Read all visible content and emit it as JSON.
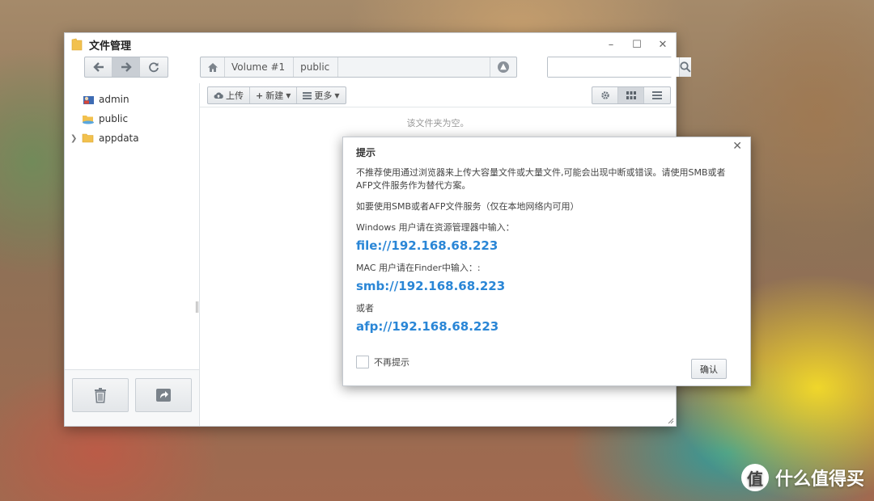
{
  "window": {
    "title": "文件管理",
    "controls": [
      "minimize-icon",
      "maximize-icon",
      "close-icon"
    ]
  },
  "path": {
    "crumbs": [
      "Volume #1",
      "public"
    ]
  },
  "search": {
    "value": "",
    "placeholder": ""
  },
  "sidebar": {
    "items": [
      {
        "label": "admin",
        "icon": "user-folder-icon"
      },
      {
        "label": "public",
        "icon": "shared-folder-icon"
      },
      {
        "label": "appdata",
        "icon": "folder-icon",
        "expandable": true
      }
    ]
  },
  "toolbar": {
    "upload_label": "上传",
    "new_label": "新建",
    "more_label": "更多"
  },
  "content": {
    "empty_message": "该文件夹为空。"
  },
  "dialog": {
    "title": "提示",
    "warning": "不推荐使用通过浏览器来上传大容量文件或大量文件,可能会出现中断或错误。请使用SMB或者AFP文件服务作为替代方案。",
    "how_to": "如要使用SMB或者AFP文件服务（仅在本地网络内可用）",
    "windows_label": "Windows 用户请在资源管理器中输入：",
    "windows_link": "file://192.168.68.223",
    "mac_label": "MAC 用户请在Finder中输入：:",
    "mac_link": "smb://192.168.68.223",
    "or_label": "或者",
    "afp_link": "afp://192.168.68.223",
    "dont_show_label": "不再提示",
    "ok_label": "确认"
  },
  "watermark": {
    "logo_char": "值",
    "text": "什么值得买"
  },
  "colors": {
    "link": "#2a86d6",
    "window_border": "#c8cdd3",
    "folder": "#f2c14e"
  }
}
